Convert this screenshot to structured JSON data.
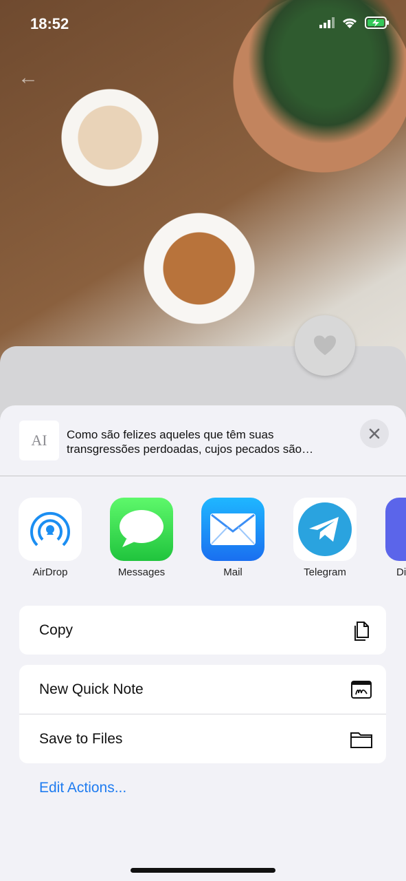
{
  "status_bar": {
    "time": "18:52"
  },
  "share_header": {
    "preview_text": "Como são felizes aqueles que têm suas transgressões perdoadas, cujos pecados são…",
    "thumb_glyph": "AI"
  },
  "apps": [
    {
      "label": "AirDrop",
      "color": "#ffffff"
    },
    {
      "label": "Messages",
      "color": "#2fcd4a"
    },
    {
      "label": "Mail",
      "color": "#1f8ef5"
    },
    {
      "label": "Telegram",
      "color": "#2aa3df"
    },
    {
      "label": "Di",
      "color": "#5b65ea"
    }
  ],
  "actions": {
    "copy": "Copy",
    "new_quick_note": "New Quick Note",
    "save_to_files": "Save to Files",
    "edit_actions": "Edit Actions..."
  }
}
